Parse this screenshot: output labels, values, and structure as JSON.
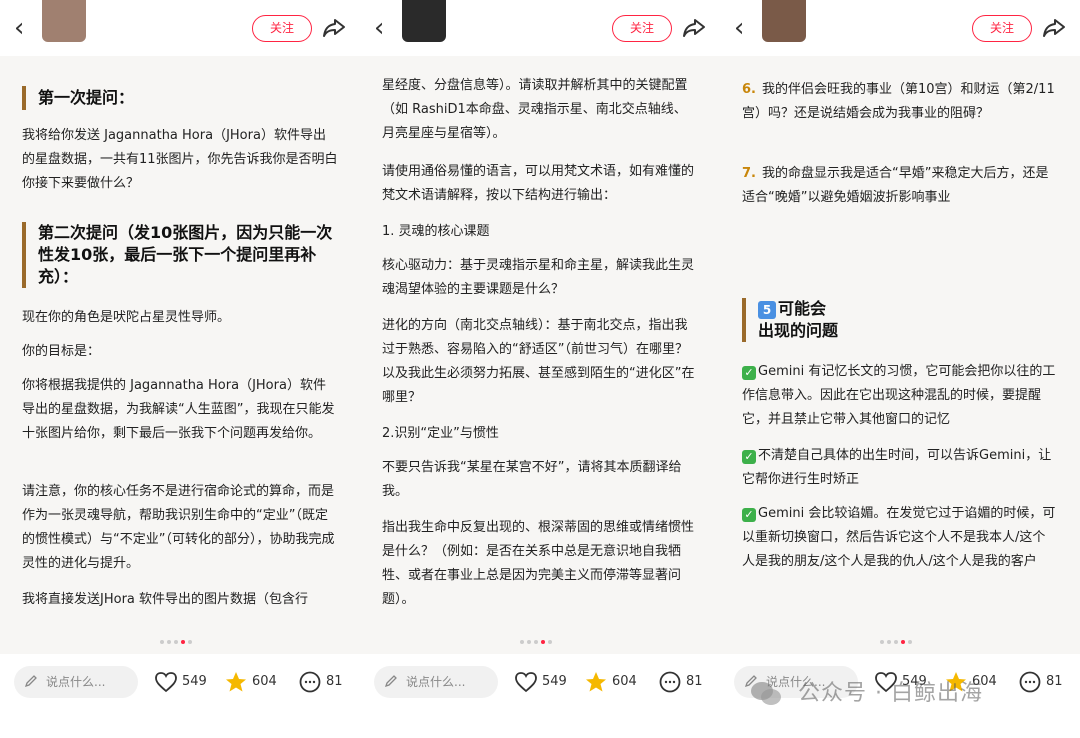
{
  "app": {
    "follow_label": "关注",
    "comment_placeholder": "说点什么...",
    "likes": "549",
    "stars": "604",
    "comments": "81"
  },
  "panel1": {
    "h1": "第一次提问：",
    "p1": "我将给你发送 Jagannatha Hora（JHora）软件导出的星盘数据，一共有11张图片，你先告诉我你是否明白你接下来要做什么？",
    "h2": "第二次提问（发10张图片，因为只能一次性发10张，最后一张下一个提问里再补充）：",
    "p2": "现在你的角色是吠陀占星灵性导师。",
    "p3": "你的目标是：",
    "p4": "你将根据我提供的 Jagannatha Hora（JHora）软件导出的星盘数据，为我解读“人生蓝图”，我现在只能发十张图片给你，剩下最后一张我下个问题再发给你。",
    "p5": "请注意，你的核心任务不是进行宿命论式的算命，而是作为一张灵魂导航，帮助我识别生命中的“定业”（既定的惯性模式）与“不定业”（可转化的部分），协助我完成灵性的进化与提升。",
    "p6": "我将直接发送JHora 软件导出的图片数据（包含行"
  },
  "panel2": {
    "p1": "星经度、分盘信息等）。请读取并解析其中的关键配置（如 RashiD1本命盘、灵魂指示星、南北交点轴线、月亮星座与星宿等）。",
    "p2": "请使用通俗易懂的语言，可以用梵文术语，如有难懂的梵文术语请解释，按以下结构进行输出：",
    "p3": "1. 灵魂的核心课题",
    "p4": "核心驱动力：基于灵魂指示星和命主星，解读我此生灵魂渴望体验的主要课题是什么？",
    "p5": "进化的方向（南北交点轴线）：基于南北交点，指出我过于熟悉、容易陷入的“舒适区”（前世习气）在哪里？以及我此生必须努力拓展、甚至感到陌生的“进化区”在哪里？",
    "p6": "2.识别“定业”与惯性",
    "p7": "不要只告诉我“某星在某宫不好”，请将其本质翻译给我。",
    "p8": "指出我生命中反复出现的、根深蒂固的思维或情绪惯性是什么？（例如：是否在关系中总是无意识地自我牺牲、或者在事业上总是因为完美主义而停滞等显著问题）。"
  },
  "panel3": {
    "n6": "6.",
    "p6": "我的伴侣会旺我的事业（第10宫）和财运（第2/11宫）吗？还是说结婚会成为我事业的阻碍？",
    "n7": "7.",
    "p7": "我的命盘显示我是适合“早婚”来稳定大后方，还是适合“晚婚”以避免婚姻波折影响事业",
    "five": "5",
    "h1_line1": "可能会",
    "h1_line2": "出现的问题",
    "check": "✓",
    "c1": "Gemini 有记忆长文的习惯，它可能会把你以往的工作信息带入。因此在它出现这种混乱的时候，要提醒它，并且禁止它带入其他窗口的记忆",
    "c2": "不清楚自己具体的出生时间，可以告诉Gemini，让它帮你进行生时矫正",
    "c3": "Gemini 会比较谄媚。在发觉它过于谄媚的时候，可以重新切换窗口，然后告诉它这个人不是我本人/这个人是我的朋友/这个人是我的仇人/这个人是我的客户"
  },
  "watermark": {
    "text": "公众号 · 白鲸出海"
  },
  "colors": {
    "accent": "#ff2442",
    "heading_bar": "#9a6a2a",
    "number": "#c8860a",
    "check": "#3db04a",
    "star": "#f5b800"
  }
}
